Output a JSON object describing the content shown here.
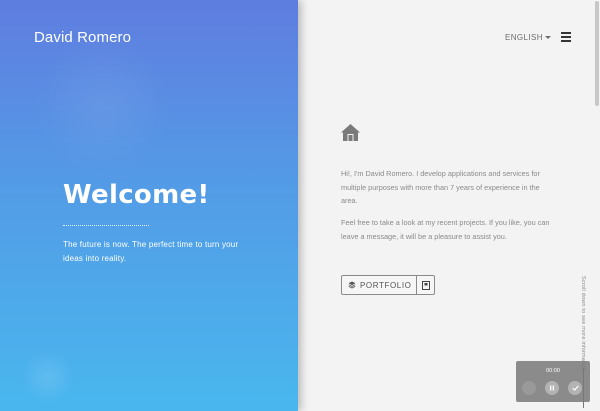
{
  "brand": {
    "name": "David Romero"
  },
  "hero": {
    "title": "Welcome!",
    "tagline": "The future is now. The perfect time to turn your ideas into reality."
  },
  "nav": {
    "language": "ENGLISH",
    "menu_icon": "hamburger-icon"
  },
  "main": {
    "home_icon": "home-icon",
    "intro_1": "Hi!, I'm David Romero. I develop applications and services for multiple purposes with more than 7 years of experience in the area.",
    "intro_2": "Feel free to take a look at my recent projects. If you like, you can leave a message, it will be a pleasure to assist you.",
    "portfolio_label": "PORTFOLIO"
  },
  "scroll_hint": "Scroll down to see more information",
  "player": {
    "time": "00:00"
  },
  "colors": {
    "gradient_top": "#5f7ddf",
    "gradient_bottom": "#49b7ee",
    "right_bg": "#f4f3f4"
  }
}
